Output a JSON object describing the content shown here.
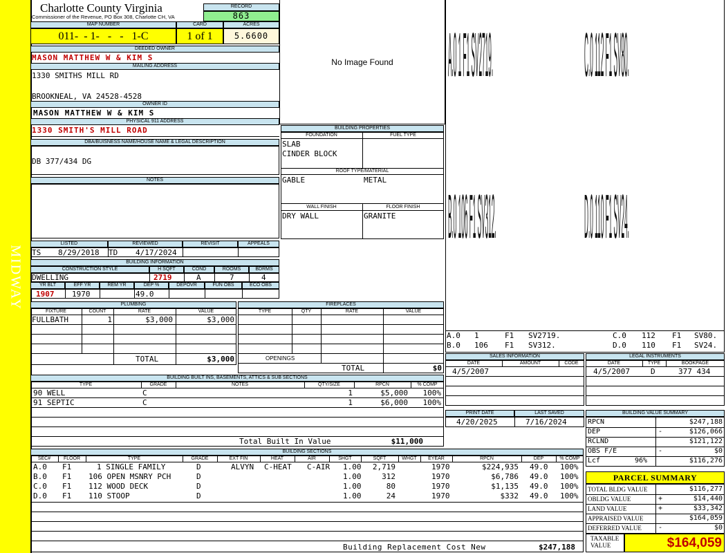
{
  "side_label": "MIDWAY",
  "header": {
    "county": "Charlotte County Virginia",
    "commissioner": "Commissioner of the Revenue, PO Box 308, Charlotte CH, VA",
    "record_label": "RECORD",
    "record": "863",
    "map_number_label": "MAP NUMBER",
    "map_number": "011-  - 1-   -   -   1-C",
    "card_label": "CARD",
    "card": "1 of 1",
    "acres_label": "ACRES",
    "acres": "5.6600"
  },
  "owner": {
    "deeded_owner_label": "DEEDED OWNER",
    "deeded_owner": "MASON MATTHEW W & KIM S",
    "mailing_address_label": "MAILING ADDRESS",
    "mailing_line1": "1330 SMITHS MILL RD",
    "mailing_line2": "BROOKNEAL, VA 24528-4528",
    "owner_id_label": "OWNER ID",
    "owner_id": "MASON MATTHEW W & KIM S",
    "physical_address_label": "PHYSICAL 911 ADDRESS",
    "physical_address": "1330 SMITH'S MILL ROAD",
    "dba_label": "DBA/BUISNESS NAME/HOUSE NAME & LEGAL DESCRIPTION",
    "dba": "DB 377/434 DG",
    "notes_label": "NOTES"
  },
  "image": {
    "no_image": "No Image Found"
  },
  "listing": {
    "listed_label": "LISTED",
    "reviewed_label": "REVIEWED",
    "revisit_label": "REVISIT",
    "appeals_label": "APPEALS",
    "listed_by": "TS",
    "listed_date": "8/29/2018",
    "reviewed_by": "TD",
    "reviewed_date": "4/17/2024"
  },
  "building_info": {
    "title": "BUILDING INFORMATION",
    "construction_label": "CONSTRUCTION STYLE",
    "hsqft_label": "H SQFT",
    "cond_label": "COND",
    "rooms_label": "ROOMS",
    "bdrms_label": "BDRMS",
    "construction": "DWELLING",
    "hsqft": "2719",
    "cond": "A",
    "rooms": "7",
    "bdrms": "4",
    "yrblt_label": "YR BLT",
    "effyr_label": "EFF YR",
    "remyr_label": "REM YR",
    "dep_label": "DEP %",
    "depovr_label": "DEPOVR",
    "funobs_label": "FUN OBS",
    "ecoobs_label": "ECO OBS",
    "yrblt": "1907",
    "effyr": "1970",
    "dep": "49.0"
  },
  "building_props": {
    "title": "BUILDING PROPERTIES",
    "foundation_label": "FOUNDATION",
    "fuel_label": "FUEL TYPE",
    "foundation1": "SLAB",
    "foundation2": "CINDER BLOCK",
    "roof_label": "ROOF TYPE/MATERIAL",
    "roof_type": "GABLE",
    "roof_material": "METAL",
    "wall_label": "WALL FINISH",
    "floor_label": "FLOOR FINISH",
    "wall": "DRY WALL",
    "floor": "GRANITE"
  },
  "plumbing": {
    "title": "PLUMBING",
    "cols": [
      "FIXTURE",
      "COUNT",
      "RATE",
      "VALUE"
    ],
    "rows": [
      {
        "fixture": "FULLBATH",
        "count": "1",
        "rate": "$3,000",
        "value": "$3,000"
      }
    ],
    "total_label": "TOTAL",
    "total": "$3,000"
  },
  "fireplaces": {
    "title": "FIREPLACES",
    "cols": [
      "TYPE",
      "QTY",
      "RATE",
      "VALUE"
    ],
    "openings_label": "OPENINGS",
    "total_label": "TOTAL",
    "total": "$0"
  },
  "builtins": {
    "title": "BUILDING BUILT INS, BASEMENTS, ATTICS & SUB SECTIONS",
    "cols": [
      "TYPE",
      "GRADE",
      "NOTES",
      "QTY/SIZE",
      "RPCN",
      "% COMP"
    ],
    "rows": [
      {
        "type": "90 WELL",
        "grade": "C",
        "qty": "1",
        "rpcn": "$5,000",
        "comp": "100%"
      },
      {
        "type": "91 SEPTIC",
        "grade": "C",
        "qty": "1",
        "rpcn": "$6,000",
        "comp": "100%"
      }
    ],
    "total_label": "Total Built In Value",
    "total": "$11,000"
  },
  "sections": {
    "title": "BUILDING SECTIONS",
    "cols": [
      "SEC#",
      "FLOOR",
      "TYPE",
      "GRADE",
      "EXT FIN",
      "HEAT",
      "AIR",
      "SHGT",
      "SQFT",
      "WHGT",
      "EYEAR",
      "RPCN",
      "DEP",
      "% COMP"
    ],
    "rows": [
      {
        "sec": "A.0",
        "floor": "F1",
        "type": "1 SINGLE FAMILY",
        "grade": "D",
        "ext": "ALVYN",
        "heat": "C-HEAT",
        "air": "C-AIR",
        "shgt": "1.00",
        "sqft": "2,719",
        "eyear": "1970",
        "rpcn": "$224,935",
        "dep": "49.0",
        "comp": "100%"
      },
      {
        "sec": "B.0",
        "floor": "F1",
        "type": "106 OPEN MSNRY PCH",
        "grade": "D",
        "ext": "",
        "heat": "",
        "air": "",
        "shgt": "1.00",
        "sqft": "312",
        "eyear": "1970",
        "rpcn": "$6,786",
        "dep": "49.0",
        "comp": "100%"
      },
      {
        "sec": "C.0",
        "floor": "F1",
        "type": "112 WOOD DECK",
        "grade": "D",
        "ext": "",
        "heat": "",
        "air": "",
        "shgt": "1.00",
        "sqft": "80",
        "eyear": "1970",
        "rpcn": "$1,135",
        "dep": "49.0",
        "comp": "100%"
      },
      {
        "sec": "D.0",
        "floor": "F1",
        "type": "110 STOOP",
        "grade": "D",
        "ext": "",
        "heat": "",
        "air": "",
        "shgt": "1.00",
        "sqft": "24",
        "eyear": "1970",
        "rpcn": "$332",
        "dep": "49.0",
        "comp": "100%"
      }
    ],
    "replacement_label": "Building Replacement Cost New",
    "replacement": "$247,188"
  },
  "sketch": {
    "tall": [
      "A.0  1   F1  SV2719.",
      "C.0  112  F1  SV80.",
      "B.0  106  F1  SV312.",
      "D.0  110  F1  SV24."
    ],
    "legend1": [
      "A.0",
      "1",
      "F1",
      "SV2719.",
      "C.0",
      "112",
      "F1",
      "SV80."
    ],
    "legend2": [
      "B.0",
      "106",
      "F1",
      "SV312.",
      "D.0",
      "110",
      "F1",
      "SV24."
    ]
  },
  "sales": {
    "title": "SALES INFORMATION",
    "cols": [
      "DATE",
      "AMOUNT",
      "CODE"
    ],
    "date": "4/5/2007"
  },
  "legal": {
    "title": "LEGAL INSTRUMENTS",
    "cols": [
      "DATE",
      "TYPE",
      "BOOKPAGE"
    ],
    "date": "4/5/2007",
    "type": "D",
    "bookpage": "377 434"
  },
  "dates": {
    "print_label": "PRINT DATE",
    "saved_label": "LAST SAVED",
    "print": "4/20/2025",
    "saved": "7/16/2024"
  },
  "value_summary": {
    "title": "BUILDING VALUE SUMMARY",
    "rpcn_label": "RPCN",
    "rpcn": "$247,188",
    "dep_label": "DEP",
    "dep_sign": "-",
    "dep": "$126,066",
    "rclnd_label": "RCLND",
    "rclnd": "$121,122",
    "obs_label": "OBS F/E",
    "obs_sign": "-",
    "obs": "$0",
    "lcf_label": "Lcf",
    "lcf_pct": "96%",
    "lcf": "$116,276"
  },
  "parcel": {
    "title": "PARCEL SUMMARY",
    "total_bldg_label": "TOTAL BLDG VALUE",
    "total_bldg": "$116,277",
    "obldg_label": "OBLDG VALUE",
    "obldg_sign": "+",
    "obldg": "$14,440",
    "land_label": "LAND VALUE",
    "land_sign": "+",
    "land": "$33,342",
    "appraised_label": "APPRAISED VALUE",
    "appraised": "$164,059",
    "deferred_label": "DEFERRED VALUE",
    "deferred_sign": "-",
    "deferred": "$0",
    "taxable_label1": "TAXABLE",
    "taxable_label2": "VALUE",
    "taxable": "$164,059"
  },
  "colors": {
    "side": "#ffff00",
    "header_bg": "#c8e4ef",
    "record_bg": "#90ee90",
    "map_bg": "#ffff00",
    "red_text": "#c00000"
  }
}
